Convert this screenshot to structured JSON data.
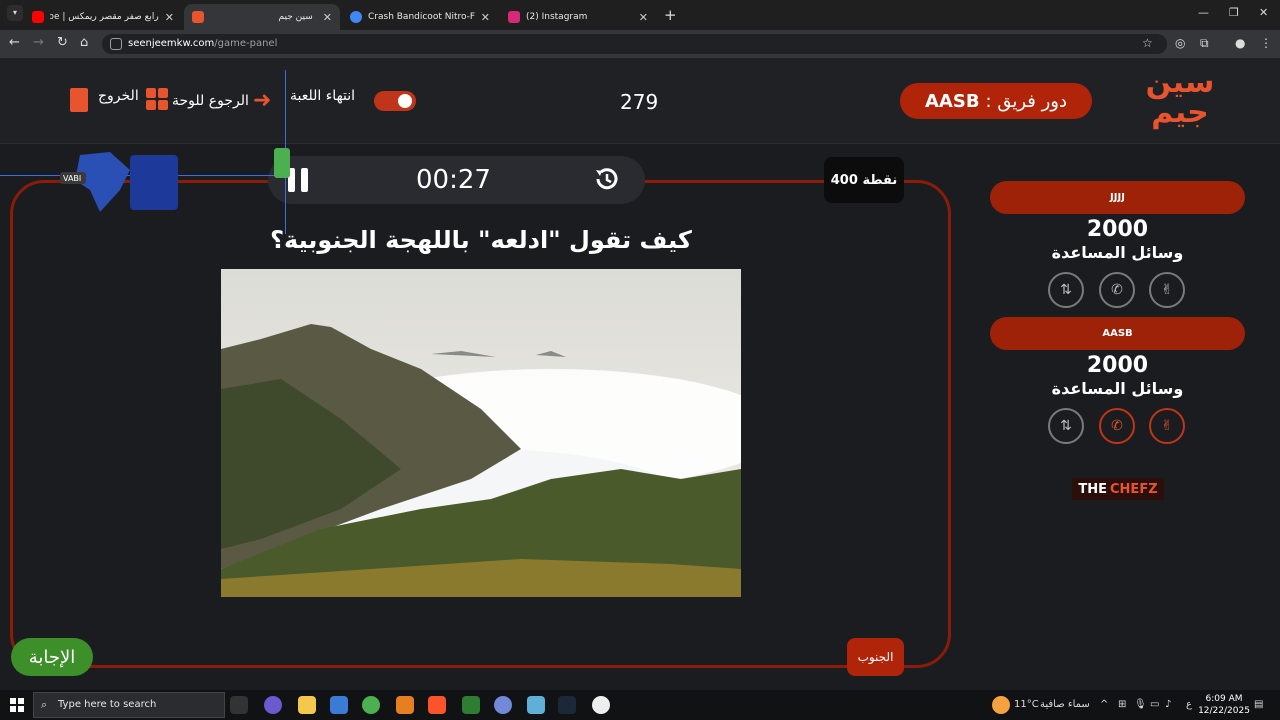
{
  "browser": {
    "tabs": [
      {
        "title": "رابع صفر مقصر ريمكس | YouTube",
        "favicon_color": "#ff0000"
      },
      {
        "title": "سين جيم",
        "favicon_color": "#e8542e"
      },
      {
        "title": "Crash Bandicoot Nitro-Fueled -",
        "favicon_color": "#4285f4"
      },
      {
        "title": "(2) Instagram",
        "favicon_color": "#d62976"
      }
    ],
    "url_host": "seenjeemkw.com",
    "url_path": "/game-panel"
  },
  "header": {
    "logo_text": "سين جيم",
    "turn_label": "دور فريق :",
    "turn_team": "AASB",
    "score": "279",
    "end_game_label": "انتهاء اللعبة",
    "back_to_board_label": "الرجوع للوحة",
    "exit_label": "الخروج"
  },
  "question": {
    "timer": "00:27",
    "points": "400 نقطة",
    "text": "كيف تقول \"ادلعه\" باللهجة الجنوبية؟",
    "region": "الجنوب",
    "answer_button": "الإجابة"
  },
  "teams": [
    {
      "name": "JJJJ",
      "score": "2000",
      "aids_label": "وسائل المساعدة",
      "aids": [
        {
          "name": "two-answers-icon",
          "used": false
        },
        {
          "name": "phone-icon",
          "used": false
        },
        {
          "name": "swap-icon",
          "used": false
        }
      ]
    },
    {
      "name": "AASB",
      "score": "2000",
      "aids_label": "وسائل المساعدة",
      "aids": [
        {
          "name": "two-answers-icon",
          "used": true
        },
        {
          "name": "phone-icon",
          "used": true
        },
        {
          "name": "swap-icon",
          "used": false
        }
      ]
    }
  ],
  "sponsor": {
    "the": "THE",
    "chefz": "CHEFZ"
  },
  "overlay": {
    "tag": "VABI"
  },
  "taskbar": {
    "search_placeholder": "Type here to search",
    "weather_temp": "11°C",
    "weather_text": "سماء صافية",
    "lang": "ع",
    "time": "6:09 AM",
    "date": "12/22/2025"
  },
  "colors": {
    "accent": "#b0240a",
    "brand_orange": "#e8542e",
    "answer_green": "#3d8f2a"
  }
}
